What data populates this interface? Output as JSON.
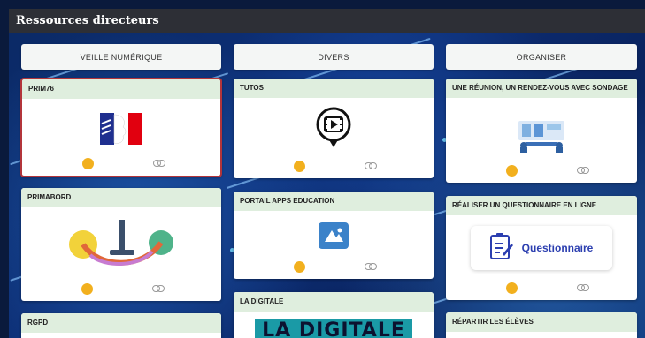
{
  "app": {
    "title": "Ressources directeurs"
  },
  "columns": [
    {
      "header": "VEILLE NUMÉRIQUE"
    },
    {
      "header": "DIVERS"
    },
    {
      "header": "ORGANISER"
    }
  ],
  "cards": {
    "prim76": {
      "title": "PRIM76"
    },
    "primabord": {
      "title": "PRIMABORD"
    },
    "rgpd": {
      "title": "RGPD"
    },
    "tutos": {
      "title": "TUTOS"
    },
    "portail": {
      "title": "PORTAIL APPS EDUCATION"
    },
    "digitale": {
      "title": "LA DIGITALE",
      "banner": "LA DIGITALE"
    },
    "reunion": {
      "title": "UNE RÉUNION, UN RENDEZ-VOUS AVEC SONDAGE"
    },
    "questionnaire": {
      "title": "RÉALISER UN QUESTIONNAIRE EN LIGNE",
      "label": "Questionnaire"
    },
    "repartir": {
      "title": "RÉPARTIR LES ÉLÈVES"
    }
  },
  "colors": {
    "topbar": "#2d2f36",
    "card_title_bg": "#dfeede",
    "author_dot": "#f2b01e",
    "board_bg": "#0d2f78",
    "digitale_bg": "#1a9aa6",
    "questionnaire_text": "#2c3fb0"
  },
  "icons": [
    "link-icon",
    "author-dot",
    "marianne-logo",
    "video-tutorial-icon",
    "meeting-illustration",
    "apps-education-logo",
    "questionnaire-icon"
  ]
}
